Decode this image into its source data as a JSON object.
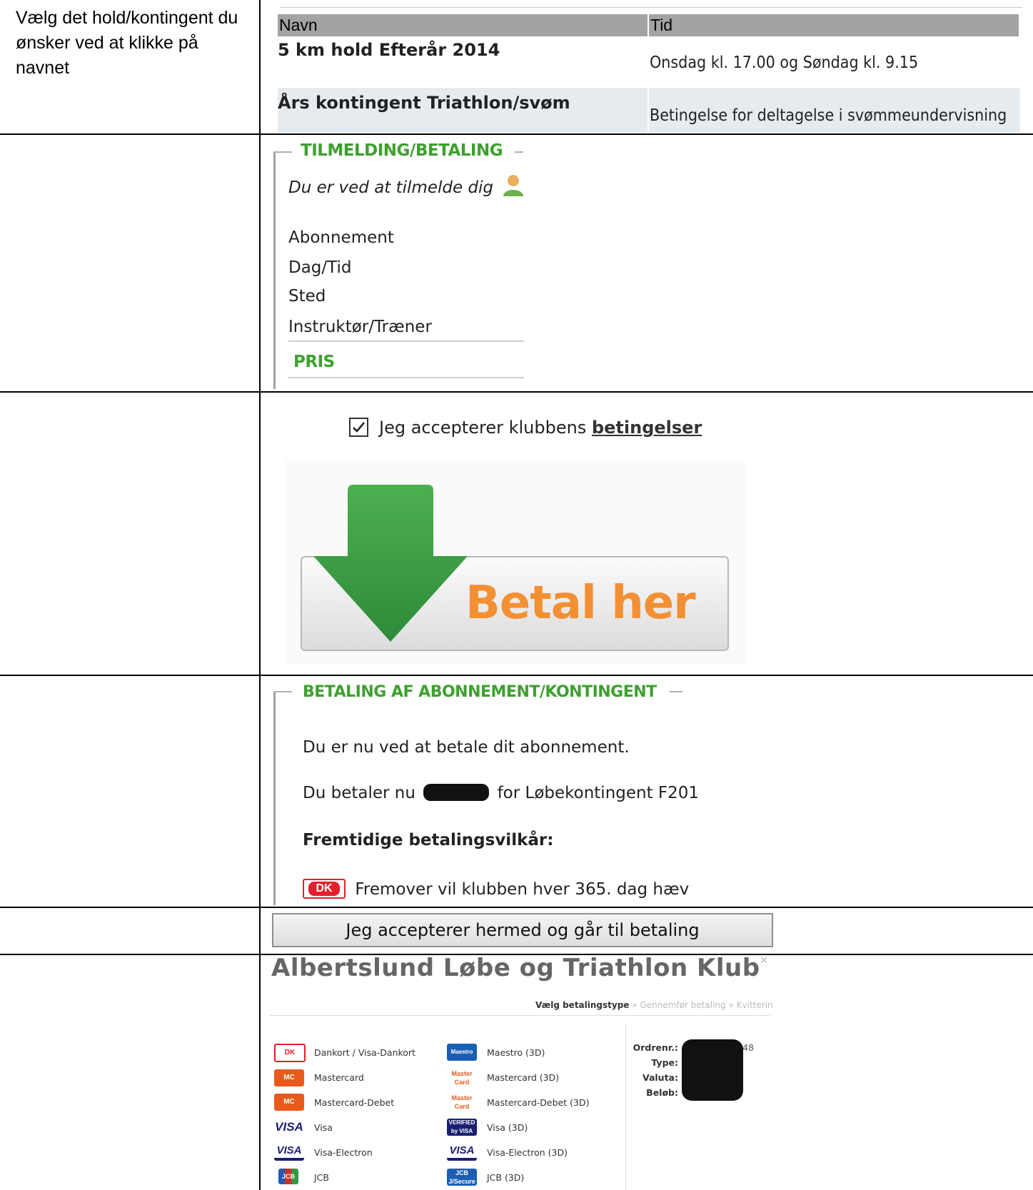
{
  "instruction": "Vælg det hold/kontingent du ønsker ved at klikke på navnet",
  "hold_table": {
    "headers": {
      "name": "Navn",
      "time": "Tid"
    },
    "rows": [
      {
        "name": "5 km hold Efterår 2014",
        "time": "Onsdag kl. 17.00 og Søndag kl. 9.15"
      },
      {
        "name": "Års kontingent Triathlon/svøm",
        "time": "Betingelse for deltagelse i svømmeundervisning"
      }
    ]
  },
  "signup": {
    "legend": "TILMELDING/BETALING",
    "intro": "Du er ved at tilmelde dig",
    "fields": [
      "Abonnement",
      "Dag/Tid",
      "Sted",
      "Instruktør/Træner"
    ],
    "price_label": "PRIS"
  },
  "terms": {
    "checked": true,
    "text": "Jeg accepterer klubbens",
    "link": "betingelser"
  },
  "pay_button": {
    "label": "Betal her"
  },
  "payment_info": {
    "legend": "BETALING AF ABONNEMENT/KONTINGENT",
    "line1": "Du er nu ved at betale dit abonnement.",
    "line2_prefix": "Du betaler nu",
    "line2_suffix": "for Løbekontingent F201",
    "terms_heading": "Fremtidige betalingsvilkår:",
    "future": "Fremover vil klubben hver 365. dag hæv",
    "card_logo": "DK"
  },
  "accept_button": {
    "label": "Jeg accepterer hermed og går til betaling"
  },
  "payment_window": {
    "title": "Albertslund Løbe og Triathlon Klub",
    "steps": [
      "Vælg betalingstype",
      "Gennemfør betaling",
      "Kvitterin"
    ],
    "methods_left": [
      "Dankort / Visa-Dankort",
      "Mastercard",
      "Mastercard-Debet",
      "Visa",
      "Visa-Electron",
      "JCB"
    ],
    "methods_right": [
      "Maestro (3D)",
      "Mastercard (3D)",
      "Mastercard-Debet (3D)",
      "Visa (3D)",
      "Visa-Electron (3D)",
      "JCB (3D)"
    ],
    "order_labels": [
      "Ordrenr.:",
      "Type:",
      "Valuta:",
      "Beløb:"
    ],
    "order_suffix": "48",
    "colors": {
      "dankort": "#e3202c",
      "mastercard": "#e85a1b",
      "visa": "#1a1f71"
    }
  }
}
